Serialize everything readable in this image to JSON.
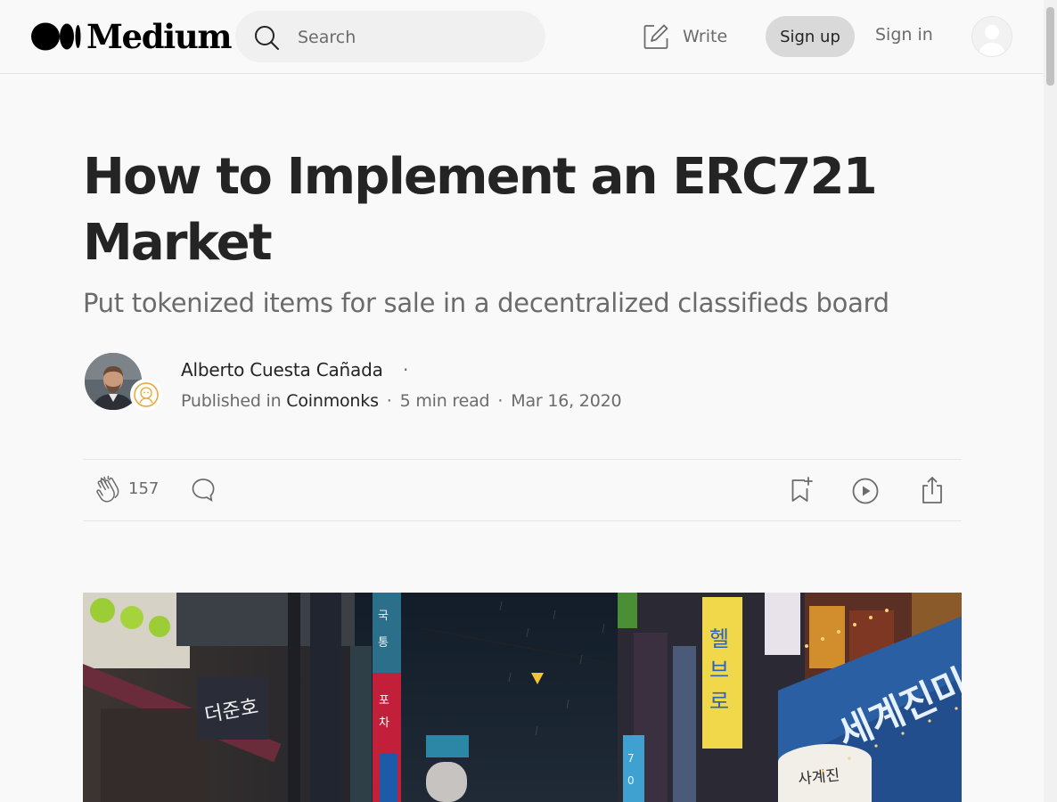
{
  "header": {
    "logo_text": "Medium",
    "search": {
      "placeholder": "Search"
    },
    "write_label": "Write",
    "signup_label": "Sign up",
    "signin_label": "Sign in",
    "icons": [
      "medium-logo",
      "search-icon",
      "write-icon",
      "user-avatar"
    ]
  },
  "article": {
    "title": "How to Implement an ERC721 Market",
    "subtitle": "Put tokenized items for sale in a decentralized classifieds board",
    "author": {
      "name": "Alberto Cuesta Cañada",
      "separator": "·"
    },
    "meta": {
      "published_prefix": "Published in",
      "publication": "Coinmonks",
      "read_time": "5 min read",
      "date": "Mar 16, 2020",
      "separator": "·"
    }
  },
  "actions": {
    "clap_count": "157",
    "icons": [
      "clap-icon",
      "comment-icon",
      "bookmark-add-icon",
      "play-icon",
      "share-icon"
    ]
  },
  "hero_image": {
    "description_icon": "neon-street-night-photo",
    "sign_texts": {
      "billboard": "세계진미",
      "lantern": "사계진",
      "vertical_yellow": "헬브로",
      "shop_sign": "더준호"
    }
  },
  "colors": {
    "background": "#f9f9f9",
    "text_primary": "#242424",
    "text_secondary": "#6b6b6b",
    "signup_bg": "#d9d9d9",
    "divider": "#e6e6e6"
  }
}
